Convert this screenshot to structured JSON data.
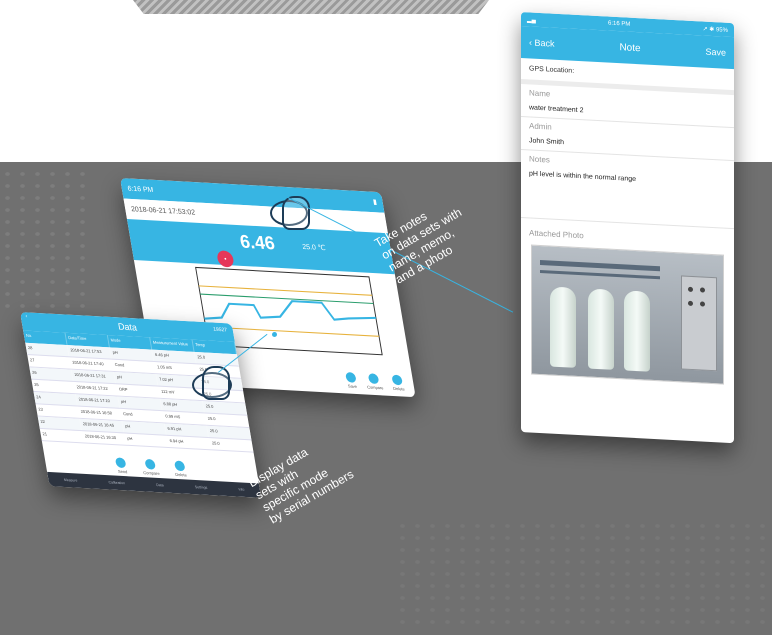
{
  "callouts": {
    "notes": [
      "Take notes",
      "on data sets with",
      "name, memo,",
      "and a photo"
    ],
    "display": [
      "Display data",
      "sets with",
      "specific mode",
      "by serial numbers"
    ]
  },
  "note_phone": {
    "status_time": "6:16 PM",
    "status_right": "↗ ✱ 95%",
    "nav_back": "‹ Back",
    "nav_title": "Note",
    "nav_save": "Save",
    "gps_label": "GPS Location:",
    "name_label": "Name",
    "name_value": "water treatment 2",
    "admin_label": "Admin",
    "admin_value": "John Smith",
    "notes_label": "Notes",
    "notes_value": "pH level is within the normal range",
    "photo_label": "Attached Photo"
  },
  "measure_phone": {
    "status_time": "6:16 PM",
    "header_date": "2018-06-21 17:53:02",
    "value": "6.46",
    "unit": "25.0 ℃",
    "buttons": [
      "Save",
      "Compare",
      "Delete"
    ]
  },
  "data_phone": {
    "title": "Data",
    "back": "‹",
    "serial": "19527",
    "columns": [
      "No.",
      "Date/Time",
      "Mode",
      "Measurement Value",
      "Temp"
    ],
    "rows": [
      [
        "28",
        "2018-06-21 17:53",
        "pH",
        "6.46 pH",
        "25.0"
      ],
      [
        "27",
        "2018-06-21 17:40",
        "Cond",
        "1.05 mS",
        "25.0"
      ],
      [
        "26",
        "2018-06-21 17:31",
        "pH",
        "7.02 pH",
        "25.0"
      ],
      [
        "25",
        "2018-06-21 17:22",
        "ORP",
        "112 mV",
        "25.0"
      ],
      [
        "24",
        "2018-06-21 17:10",
        "pH",
        "6.88 pH",
        "25.0"
      ],
      [
        "23",
        "2018-06-21 16:58",
        "Cond",
        "0.99 mS",
        "25.0"
      ],
      [
        "22",
        "2018-06-21 16:45",
        "pH",
        "6.91 pH",
        "25.0"
      ],
      [
        "21",
        "2018-06-21 16:30",
        "pH",
        "6.94 pH",
        "25.0"
      ]
    ],
    "footer_buttons": [
      "Send",
      "Compare",
      "Delete"
    ],
    "tabs": [
      "Measure",
      "Calibration",
      "Data",
      "Settings",
      "Info"
    ]
  }
}
